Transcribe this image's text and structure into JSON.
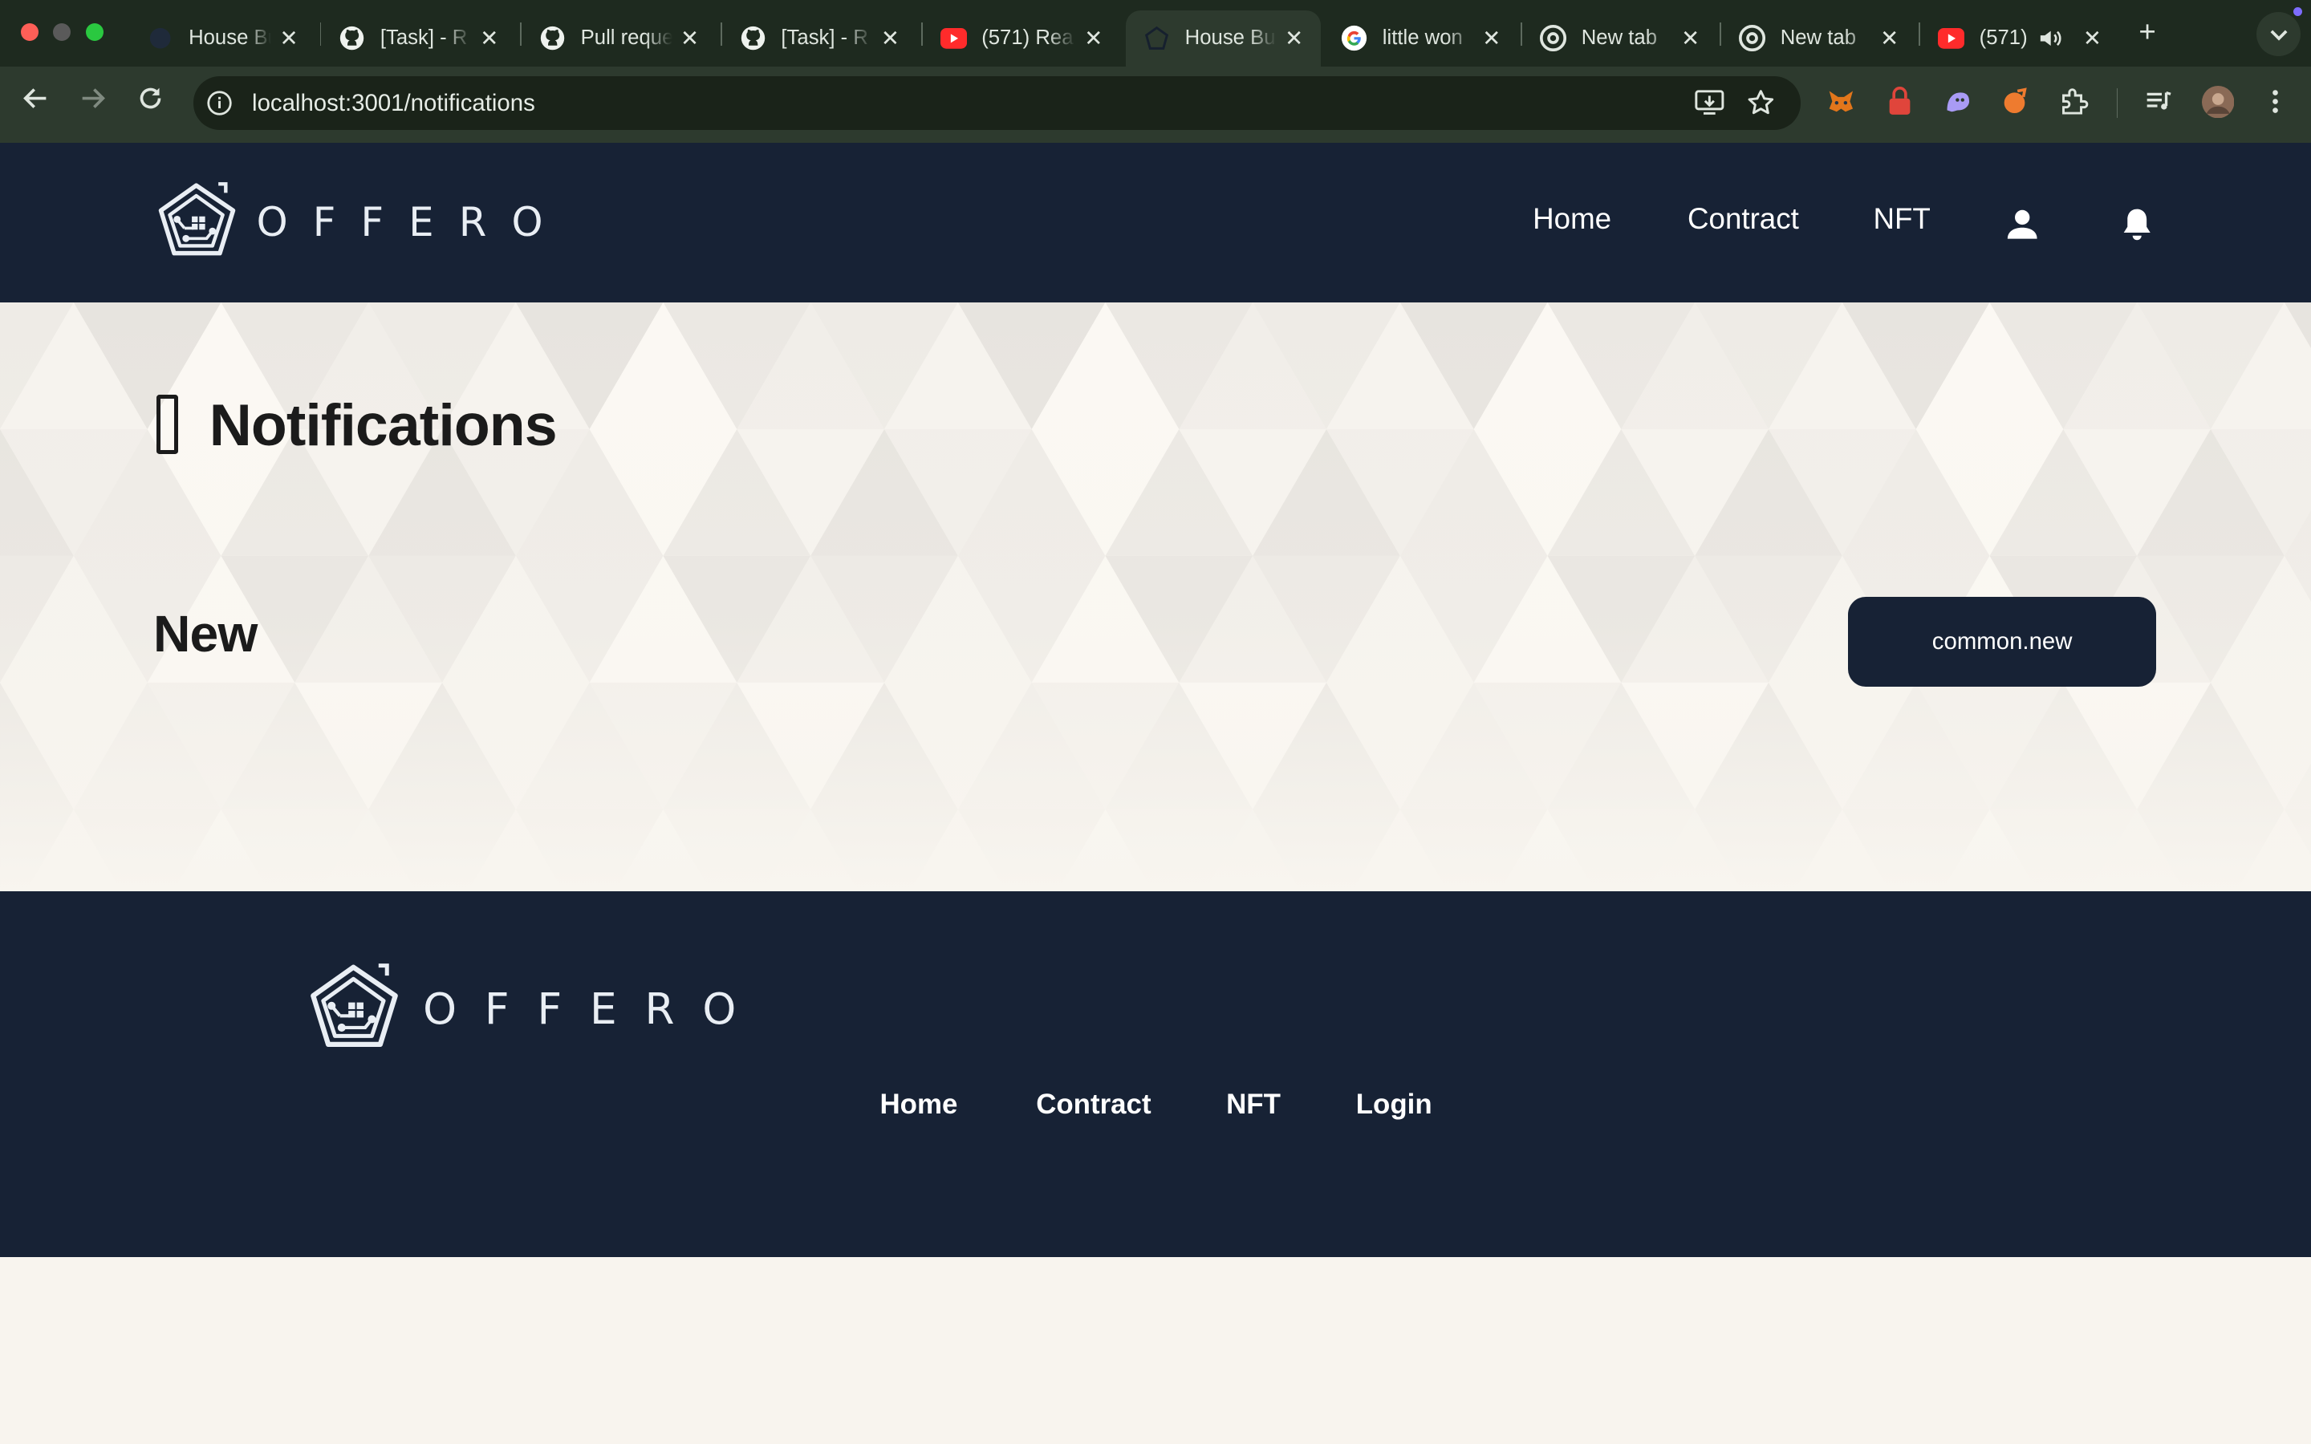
{
  "browser": {
    "tabs": [
      {
        "title": "House Bu",
        "favicon": "house-logo",
        "active": false
      },
      {
        "title": "[Task] - R",
        "favicon": "github",
        "active": false
      },
      {
        "title": "Pull reque",
        "favicon": "github",
        "active": false
      },
      {
        "title": "[Task] - R",
        "favicon": "github",
        "active": false
      },
      {
        "title": "(571) Rea",
        "favicon": "youtube",
        "active": false
      },
      {
        "title": "House Bu",
        "favicon": "house-logo",
        "active": true
      },
      {
        "title": "little won",
        "favicon": "google",
        "active": false
      },
      {
        "title": "New tab",
        "favicon": "chrome",
        "active": false
      },
      {
        "title": "New tab",
        "favicon": "chrome",
        "active": false
      },
      {
        "title": "(571)",
        "favicon": "youtube",
        "active": false
      }
    ],
    "url": "localhost:3001/notifications",
    "colors": {
      "frame": "#1e2a1f",
      "toolbar": "#2d3a2e",
      "omnibox": "#1a2319"
    }
  },
  "header": {
    "brand": "OFFERO",
    "nav": {
      "home": "Home",
      "contract": "Contract",
      "nft": "NFT"
    },
    "colors": {
      "background": "#172235",
      "text": "#ffffff"
    }
  },
  "main": {
    "page_title": "Notifications",
    "section_title": "New",
    "new_button": "common.new",
    "colors": {
      "background": "#f8f5ef",
      "button": "#172235"
    }
  },
  "footer": {
    "brand": "OFFERO",
    "nav": {
      "home": "Home",
      "contract": "Contract",
      "nft": "NFT",
      "login": "Login"
    }
  }
}
